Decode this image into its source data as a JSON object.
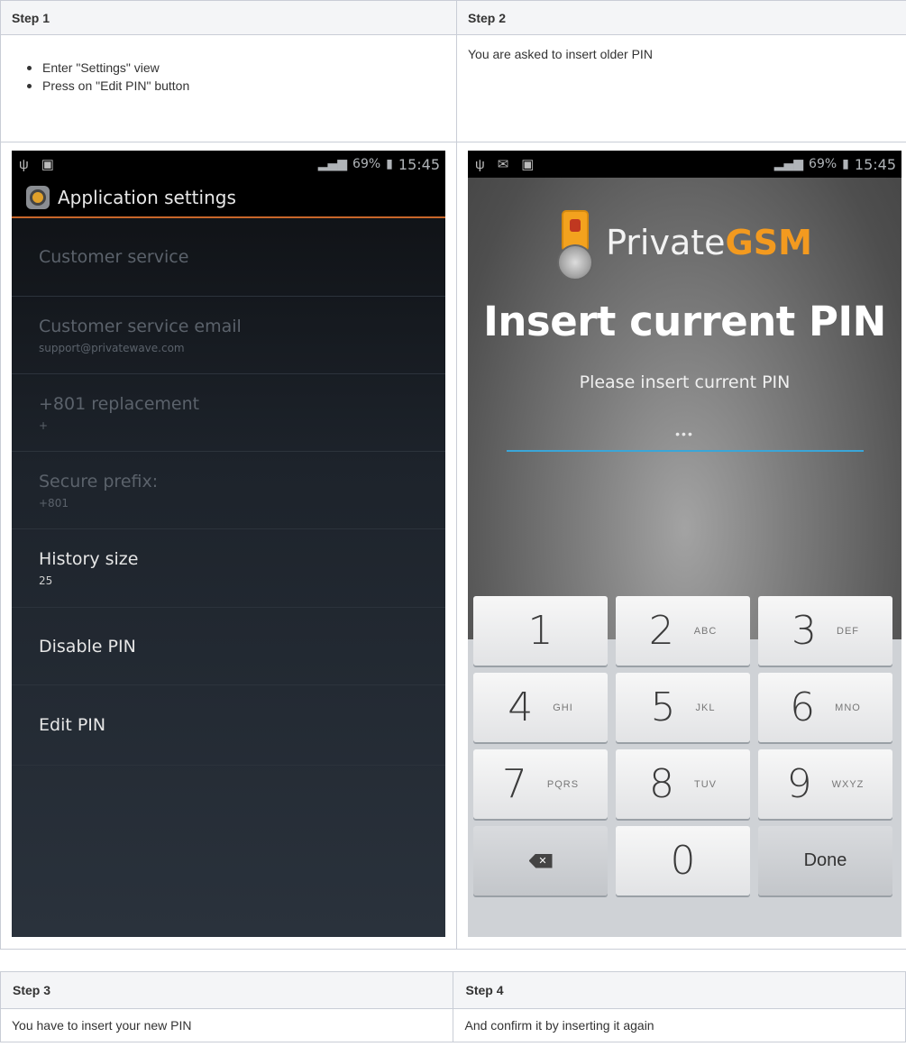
{
  "table1": {
    "headers": [
      "Step 1",
      "Step 2"
    ],
    "step1_bullets": [
      "Enter \"Settings\" view",
      "Press on \"Edit PIN\" button"
    ],
    "step2_text": "You are asked to insert older PIN"
  },
  "phone1": {
    "status": {
      "time": "15:45",
      "battery": "69%"
    },
    "title": "Application settings",
    "prefs": [
      {
        "title": "Customer service",
        "summary": "",
        "enabled": false
      },
      {
        "title": "Customer service email",
        "summary": "support@privatewave.com",
        "enabled": false
      },
      {
        "title": "+801 replacement",
        "summary": "+",
        "enabled": false
      },
      {
        "title": "Secure prefix:",
        "summary": "+801",
        "enabled": false
      },
      {
        "title": "History size",
        "summary": "25",
        "enabled": true
      },
      {
        "title": "Disable PIN",
        "summary": "",
        "enabled": true
      },
      {
        "title": "Edit PIN",
        "summary": "",
        "enabled": true
      }
    ]
  },
  "phone2": {
    "status": {
      "time": "15:45",
      "battery": "69%"
    },
    "logo_plain": "Private",
    "logo_bold": "GSM",
    "title": "Insert current PIN",
    "subtitle": "Please insert current PIN",
    "pin_value": "•••",
    "keys": [
      {
        "n": "1",
        "l": ""
      },
      {
        "n": "2",
        "l": "ABC"
      },
      {
        "n": "3",
        "l": "DEF"
      },
      {
        "n": "4",
        "l": "GHI"
      },
      {
        "n": "5",
        "l": "JKL"
      },
      {
        "n": "6",
        "l": "MNO"
      },
      {
        "n": "7",
        "l": "PQRS"
      },
      {
        "n": "8",
        "l": "TUV"
      },
      {
        "n": "9",
        "l": "WXYZ"
      }
    ],
    "zero": "0",
    "done": "Done"
  },
  "table2": {
    "headers": [
      "Step 3",
      "Step 4"
    ],
    "step3_text": "You have to insert your new PIN",
    "step4_text": "And confirm it by inserting it again"
  }
}
